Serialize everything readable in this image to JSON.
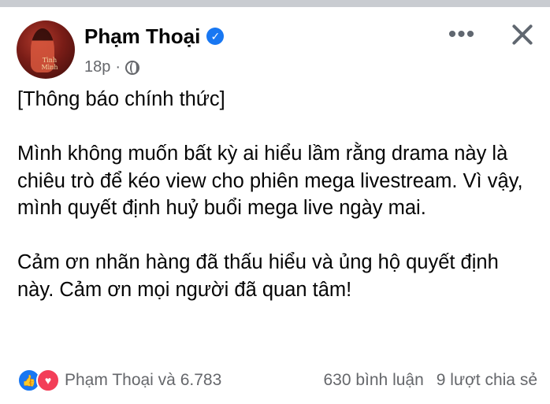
{
  "post": {
    "author": "Phạm Thoại",
    "time": "18p",
    "dot": "·",
    "avatar_caption": "Tình Mình",
    "title_line": "[Thông báo chính thức]",
    "paragraph1": "Mình không muốn bất kỳ ai hiểu lầm rằng drama này là chiêu trò để kéo view cho phiên mega livestream. Vì vậy, mình quyết định huỷ buổi mega live ngày mai.",
    "paragraph2": "Cảm ơn nhãn hàng đã thấu hiểu và ủng hộ quyết định này. Cảm ơn mọi người đã quan tâm!"
  },
  "footer": {
    "reactors": "Phạm Thoại và 6.783",
    "comments": "630 bình luận",
    "shares": "9 lượt chia sẻ"
  },
  "icons": {
    "verified": "verified-badge-icon",
    "audience": "globe-icon",
    "more": "more-options-icon",
    "close": "close-icon",
    "like": "like-reaction-icon",
    "love": "love-reaction-icon"
  },
  "colors": {
    "brand": "#1877f2",
    "love": "#f33e58",
    "secondary_text": "#65676b"
  }
}
